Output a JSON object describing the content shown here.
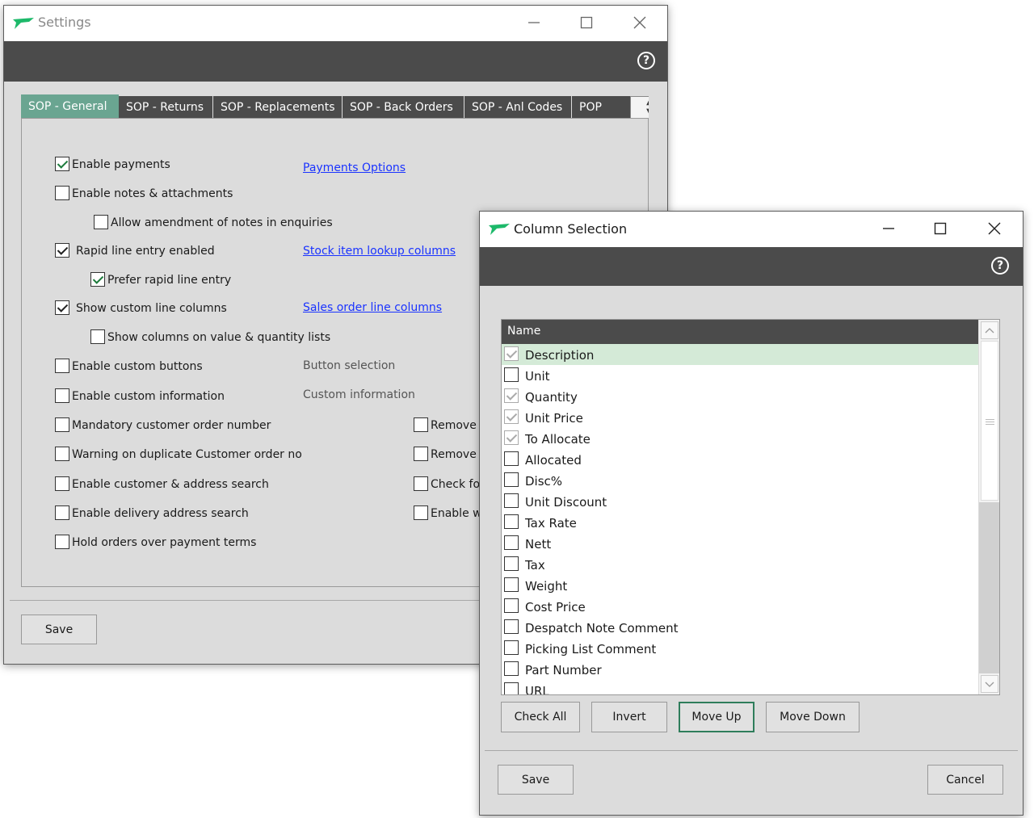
{
  "colors": {
    "accent_green": "#6aa591",
    "dark_bar": "#4b4b4b",
    "link_blue": "#1a33ff",
    "selected_row": "#d4ead7",
    "check_green": "#1d7b3c"
  },
  "settings": {
    "title": "Settings",
    "tabs": [
      {
        "label": "SOP - General"
      },
      {
        "label": "SOP - Returns"
      },
      {
        "label": "SOP - Replacements"
      },
      {
        "label": "SOP - Back Orders"
      },
      {
        "label": "SOP - Anl Codes"
      },
      {
        "label": "POP"
      }
    ],
    "options": [
      {
        "label": "Enable payments",
        "checked": true
      },
      {
        "label": "Enable notes & attachments",
        "checked": false
      },
      {
        "label": "Allow amendment of notes in enquiries",
        "checked": false
      },
      {
        "label": "Rapid line entry enabled",
        "checked": true
      },
      {
        "label": "Prefer rapid line entry",
        "checked": true
      },
      {
        "label": "Show custom line columns",
        "checked": true
      },
      {
        "label": "Show columns on value & quantity lists",
        "checked": false
      },
      {
        "label": "Enable custom buttons",
        "checked": false
      },
      {
        "label": "Enable custom information",
        "checked": false
      },
      {
        "label": "Mandatory customer order number",
        "checked": false
      },
      {
        "label": "Warning on duplicate Customer order no",
        "checked": false
      },
      {
        "label": "Enable customer & address search",
        "checked": false
      },
      {
        "label": "Enable delivery address search",
        "checked": false
      },
      {
        "label": "Hold orders over payment terms",
        "checked": false
      }
    ],
    "right_options": [
      {
        "label": "Remove",
        "checked": false
      },
      {
        "label": "Remove",
        "checked": false
      },
      {
        "label": "Check fo",
        "checked": false
      },
      {
        "label": "Enable w",
        "checked": false
      }
    ],
    "links": {
      "payments_options": "Payments Options",
      "stock_item_lookup_columns": "Stock item lookup columns",
      "sales_order_line_columns": "Sales order line columns"
    },
    "static": {
      "button_selection": "Button selection",
      "custom_information": "Custom information"
    },
    "save_label": "Save"
  },
  "column_selection": {
    "title": "Column Selection",
    "header": "Name",
    "rows": [
      {
        "label": "Description",
        "checked": true,
        "disabled": true,
        "selected": true
      },
      {
        "label": "Unit",
        "checked": false
      },
      {
        "label": "Quantity",
        "checked": true,
        "disabled": true
      },
      {
        "label": "Unit Price",
        "checked": true,
        "disabled": true
      },
      {
        "label": "To Allocate",
        "checked": true,
        "disabled": true
      },
      {
        "label": "Allocated",
        "checked": false
      },
      {
        "label": "Disc%",
        "checked": false
      },
      {
        "label": "Unit Discount",
        "checked": false
      },
      {
        "label": "Tax Rate",
        "checked": false
      },
      {
        "label": "Nett",
        "checked": false
      },
      {
        "label": "Tax",
        "checked": false
      },
      {
        "label": "Weight",
        "checked": false
      },
      {
        "label": "Cost Price",
        "checked": false
      },
      {
        "label": "Despatch Note Comment",
        "checked": false
      },
      {
        "label": "Picking List Comment",
        "checked": false
      },
      {
        "label": "Part Number",
        "checked": false
      },
      {
        "label": "URL",
        "checked": false
      }
    ],
    "buttons": {
      "check_all": "Check All",
      "invert": "Invert",
      "move_up": "Move Up",
      "move_down": "Move Down",
      "save": "Save",
      "cancel": "Cancel"
    }
  }
}
